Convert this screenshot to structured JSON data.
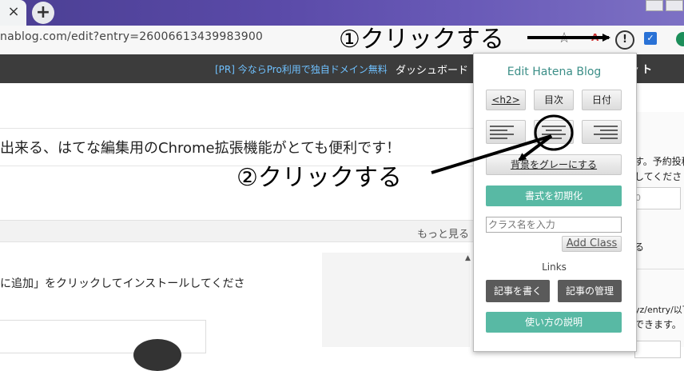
{
  "browser": {
    "tab_close": "×",
    "new_tab": "+",
    "url": "nablog.com/edit?entry=26006613439983900"
  },
  "blog_header": {
    "pr_link": "[PR] 今ならPro利用で独自ドメイン無料",
    "dashboard": "ダッシュボード",
    "menu": "▾ ト"
  },
  "editor": {
    "title": "出来る、はてな編集用のChrome拡張機能がとても便利です！",
    "more_link": "もっと見る",
    "body_text": "に追加」をクリックしてインストールしてくださ"
  },
  "sidebar": {
    "line1": "す。予約投稿",
    "line2": "してくださ",
    "input_value": "0",
    "line3": "る",
    "line4": "yz/entry/以下",
    "line5": "できます。"
  },
  "popup": {
    "title": "Edit Hatena Blog",
    "h2_button": "<h2>",
    "toc_button": "目次",
    "date_button": "日付",
    "gray_bg_button": "背景をグレーにする",
    "reset_format_button": "書式を初期化",
    "class_input_placeholder": "クラス名を入力",
    "add_class_button": "Add Class",
    "links_label": "Links",
    "write_post_button": "記事を書く",
    "manage_posts_button": "記事の管理",
    "how_to_button": "使い方の説明"
  },
  "annotations": {
    "step1": "①クリックする",
    "step2": "②クリックする"
  },
  "colors": {
    "popup_accent": "#58b9a4",
    "popup_dark_button": "#5a5a5a",
    "header_bg": "#3c3c3c",
    "pr_link": "#6fc1ff"
  }
}
